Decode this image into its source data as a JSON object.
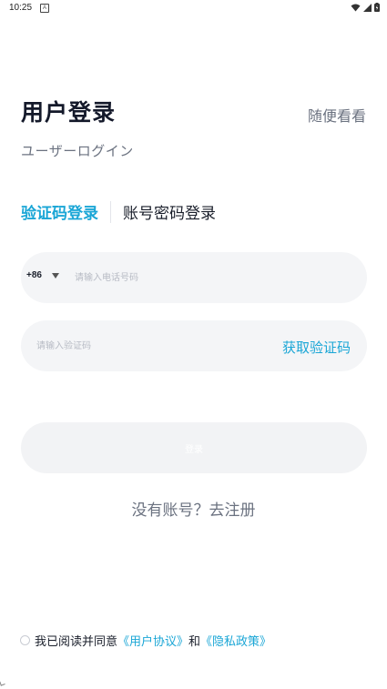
{
  "status_bar": {
    "time": "10:25",
    "notification_glyph": "A",
    "icons": [
      "wifi-icon",
      "signal-icon",
      "battery-icon"
    ]
  },
  "header": {
    "title": "用户登录",
    "subtitle": "ユーザーログイン",
    "browse_label": "随便看看"
  },
  "tabs": [
    {
      "label": "验证码登录",
      "active": true
    },
    {
      "label": "账号密码登录",
      "active": false
    }
  ],
  "phone_field": {
    "country_code": "+86",
    "placeholder": "请输入电话号码",
    "value": ""
  },
  "code_field": {
    "placeholder": "请输入验证码",
    "value": "",
    "get_code_label": "获取验证码"
  },
  "login_button": {
    "label": "登录"
  },
  "register_link": {
    "label": "没有账号？去注册"
  },
  "agreement": {
    "checked": false,
    "prefix": "我已阅读并同意",
    "user_agreement": "《用户协议》",
    "conjunction": "和",
    "privacy_policy": "《隐私政策》"
  },
  "colors": {
    "accent": "#1aa6d6",
    "title": "#14192a",
    "muted": "#6b7280",
    "field_bg": "#f4f5f7",
    "button_disabled_bg": "#f2f3f5"
  }
}
